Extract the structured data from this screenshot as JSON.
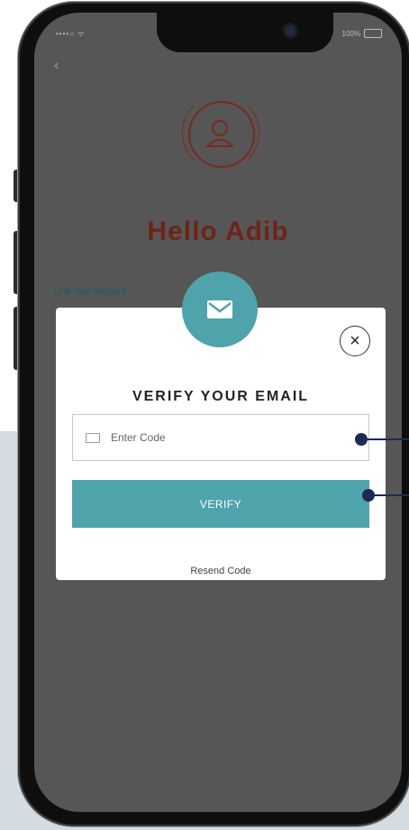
{
  "status_bar": {
    "carrier": "••••○ ᯤ",
    "battery_percent": "100%"
  },
  "nav": {
    "back_glyph": "‹"
  },
  "profile": {
    "greeting": "Hello Adib",
    "link_label": "Link Your Account"
  },
  "modal": {
    "title": "VERIFY YOUR EMAIL",
    "code_placeholder": "Enter Code",
    "verify_label": "VERIFY",
    "resend_label": "Resend Code",
    "close_glyph": "×"
  },
  "colors": {
    "accent": "#4fa3ab",
    "greeting": "#6e2418",
    "overlay": "#565656",
    "callout": "#1b2a5a"
  },
  "icons": [
    "mail-icon",
    "user-icon",
    "close-icon",
    "code-icon",
    "back-arrow-icon"
  ]
}
